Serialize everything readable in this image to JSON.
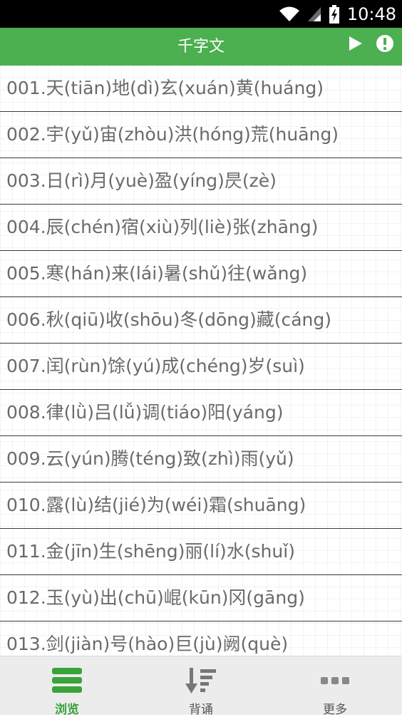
{
  "status_bar": {
    "time": "10:48",
    "icons": [
      "wifi-icon",
      "signal-icon",
      "battery-charging-icon"
    ]
  },
  "header": {
    "title": "千字文",
    "actions": [
      "play-icon",
      "info-icon"
    ]
  },
  "colors": {
    "accent": "#4caf50",
    "active_tab": "#3aa339",
    "text": "#6a6a6a"
  },
  "list": {
    "items": [
      "001.天(tiān)地(dì)玄(xuán)黄(huáng)",
      "002.宇(yǔ)宙(zhòu)洪(hóng)荒(huāng)",
      "003.日(rì)月(yuè)盈(yíng)昃(zè)",
      "004.辰(chén)宿(xiù)列(liè)张(zhāng)",
      "005.寒(hán)来(lái)暑(shǔ)往(wǎng)",
      "006.秋(qiū)收(shōu)冬(dōng)藏(cáng)",
      "007.闰(rùn)馀(yú)成(chéng)岁(suì)",
      "008.律(lǜ)吕(lǚ)调(tiáo)阳(yáng)",
      "009.云(yún)腾(téng)致(zhì)雨(yǔ)",
      "010.露(lù)结(jié)为(wéi)霜(shuāng)",
      "011.金(jīn)生(shēng)丽(lí)水(shuǐ)",
      "012.玉(yù)出(chū)崐(kūn)冈(gāng)",
      "013.剑(jiàn)号(hào)巨(jù)阙(què)"
    ]
  },
  "bottom_nav": {
    "tabs": [
      {
        "label": "浏览",
        "icon": "browse-icon",
        "active": true
      },
      {
        "label": "背诵",
        "icon": "recite-sort-icon",
        "active": false
      },
      {
        "label": "更多",
        "icon": "more-icon",
        "active": false
      }
    ]
  }
}
